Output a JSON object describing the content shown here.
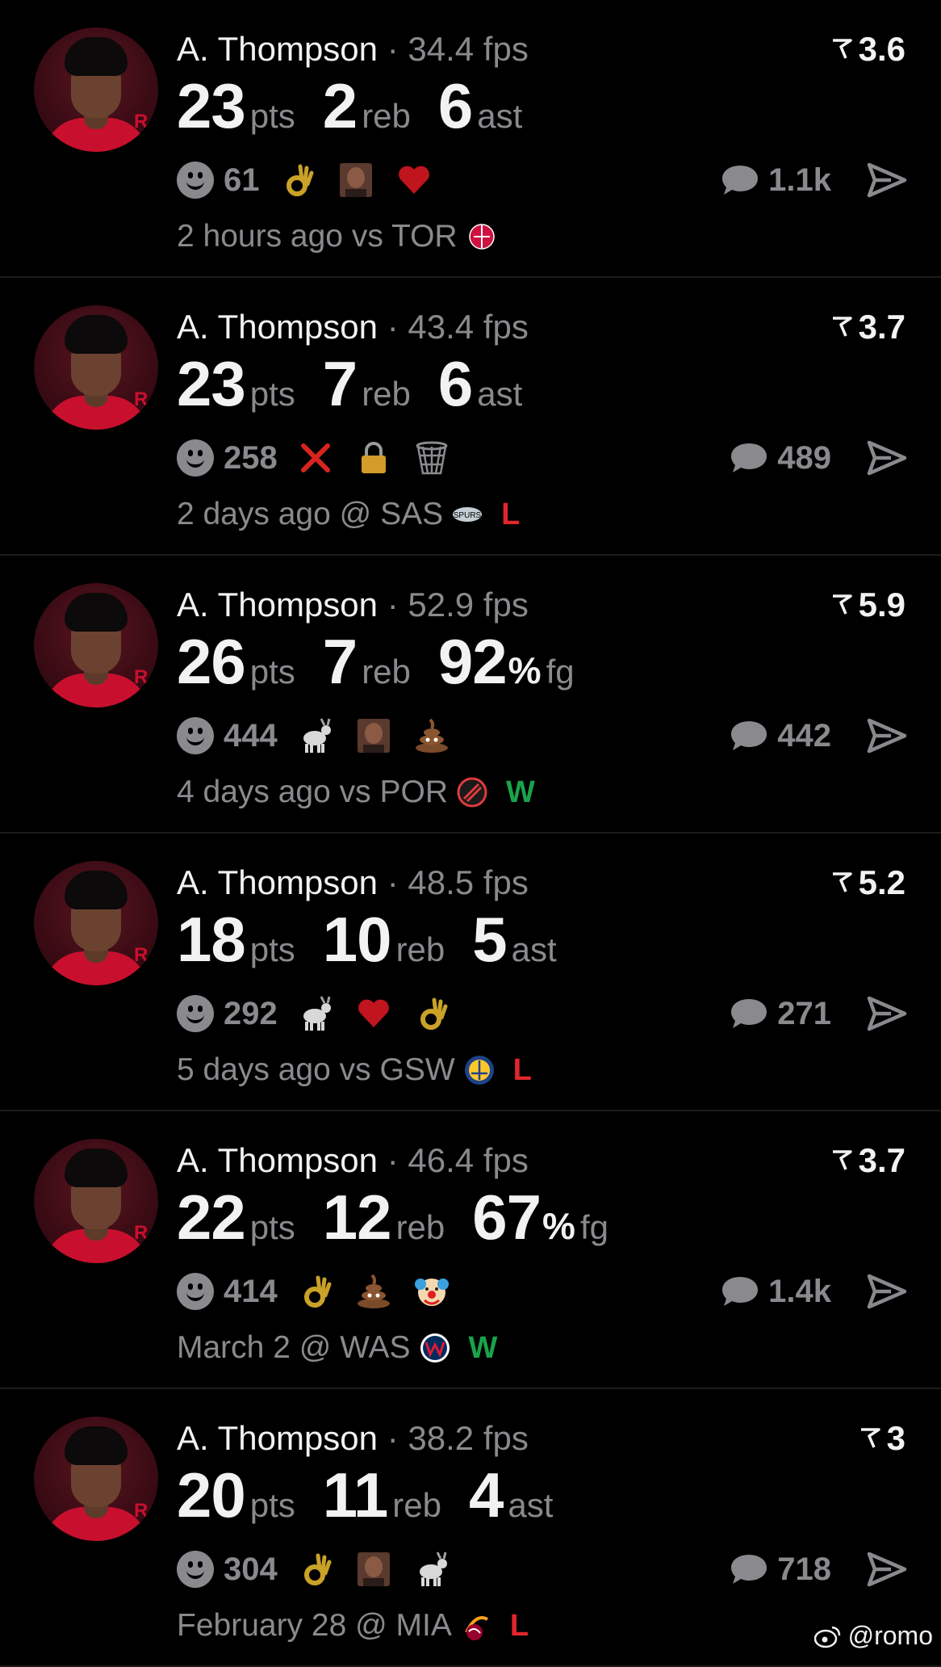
{
  "colors": {
    "background": "#000000",
    "primary_text": "#f2f2f2",
    "secondary_text": "#8a8a8e",
    "loss": "#e0262c",
    "win": "#1aa34a",
    "divider": "#1c1c1e"
  },
  "posts": [
    {
      "player": "A. Thompson",
      "separator": "·",
      "fps": "34.4 fps",
      "rating": "3.6",
      "stats": [
        {
          "value": "23",
          "pct": "",
          "unit": "pts"
        },
        {
          "value": "2",
          "pct": "",
          "unit": "reb"
        },
        {
          "value": "6",
          "pct": "",
          "unit": "ast"
        }
      ],
      "reaction_count": "61",
      "emojis": [
        "ok-hand-icon",
        "photo-face-icon",
        "heart-icon"
      ],
      "comment_count": "1.1k",
      "time": "2 hours ago vs TOR",
      "team_logo": "raptors-logo",
      "result": ""
    },
    {
      "player": "A. Thompson",
      "separator": "·",
      "fps": "43.4 fps",
      "rating": "3.7",
      "stats": [
        {
          "value": "23",
          "pct": "",
          "unit": "pts"
        },
        {
          "value": "7",
          "pct": "",
          "unit": "reb"
        },
        {
          "value": "6",
          "pct": "",
          "unit": "ast"
        }
      ],
      "reaction_count": "258",
      "emojis": [
        "cross-mark-icon",
        "lock-icon",
        "basket-net-icon"
      ],
      "comment_count": "489",
      "time": "2 days ago @ SAS",
      "team_logo": "spurs-logo",
      "result": "L"
    },
    {
      "player": "A. Thompson",
      "separator": "·",
      "fps": "52.9 fps",
      "rating": "5.9",
      "stats": [
        {
          "value": "26",
          "pct": "",
          "unit": "pts"
        },
        {
          "value": "7",
          "pct": "",
          "unit": "reb"
        },
        {
          "value": "92",
          "pct": "%",
          "unit": "fg"
        }
      ],
      "reaction_count": "444",
      "emojis": [
        "goat-icon",
        "photo-face-icon",
        "poop-icon"
      ],
      "comment_count": "442",
      "time": "4 days ago vs POR",
      "team_logo": "blazers-logo",
      "result": "W"
    },
    {
      "player": "A. Thompson",
      "separator": "·",
      "fps": "48.5 fps",
      "rating": "5.2",
      "stats": [
        {
          "value": "18",
          "pct": "",
          "unit": "pts"
        },
        {
          "value": "10",
          "pct": "",
          "unit": "reb"
        },
        {
          "value": "5",
          "pct": "",
          "unit": "ast"
        }
      ],
      "reaction_count": "292",
      "emojis": [
        "goat-icon",
        "heart-icon",
        "ok-hand-icon"
      ],
      "comment_count": "271",
      "time": "5 days ago vs GSW",
      "team_logo": "warriors-logo",
      "result": "L"
    },
    {
      "player": "A. Thompson",
      "separator": "·",
      "fps": "46.4 fps",
      "rating": "3.7",
      "stats": [
        {
          "value": "22",
          "pct": "",
          "unit": "pts"
        },
        {
          "value": "12",
          "pct": "",
          "unit": "reb"
        },
        {
          "value": "67",
          "pct": "%",
          "unit": "fg"
        }
      ],
      "reaction_count": "414",
      "emojis": [
        "ok-hand-icon",
        "poop-icon",
        "clown-icon"
      ],
      "comment_count": "1.4k",
      "time": "March 2 @ WAS",
      "team_logo": "wizards-logo",
      "result": "W"
    },
    {
      "player": "A. Thompson",
      "separator": "·",
      "fps": "38.2 fps",
      "rating": "3",
      "stats": [
        {
          "value": "20",
          "pct": "",
          "unit": "pts"
        },
        {
          "value": "11",
          "pct": "",
          "unit": "reb"
        },
        {
          "value": "4",
          "pct": "",
          "unit": "ast"
        }
      ],
      "reaction_count": "304",
      "emojis": [
        "ok-hand-icon",
        "photo-face-icon",
        "goat-icon"
      ],
      "comment_count": "718",
      "time": "February 28 @ MIA",
      "team_logo": "heat-logo",
      "result": "L"
    }
  ],
  "watermark": "@romo"
}
